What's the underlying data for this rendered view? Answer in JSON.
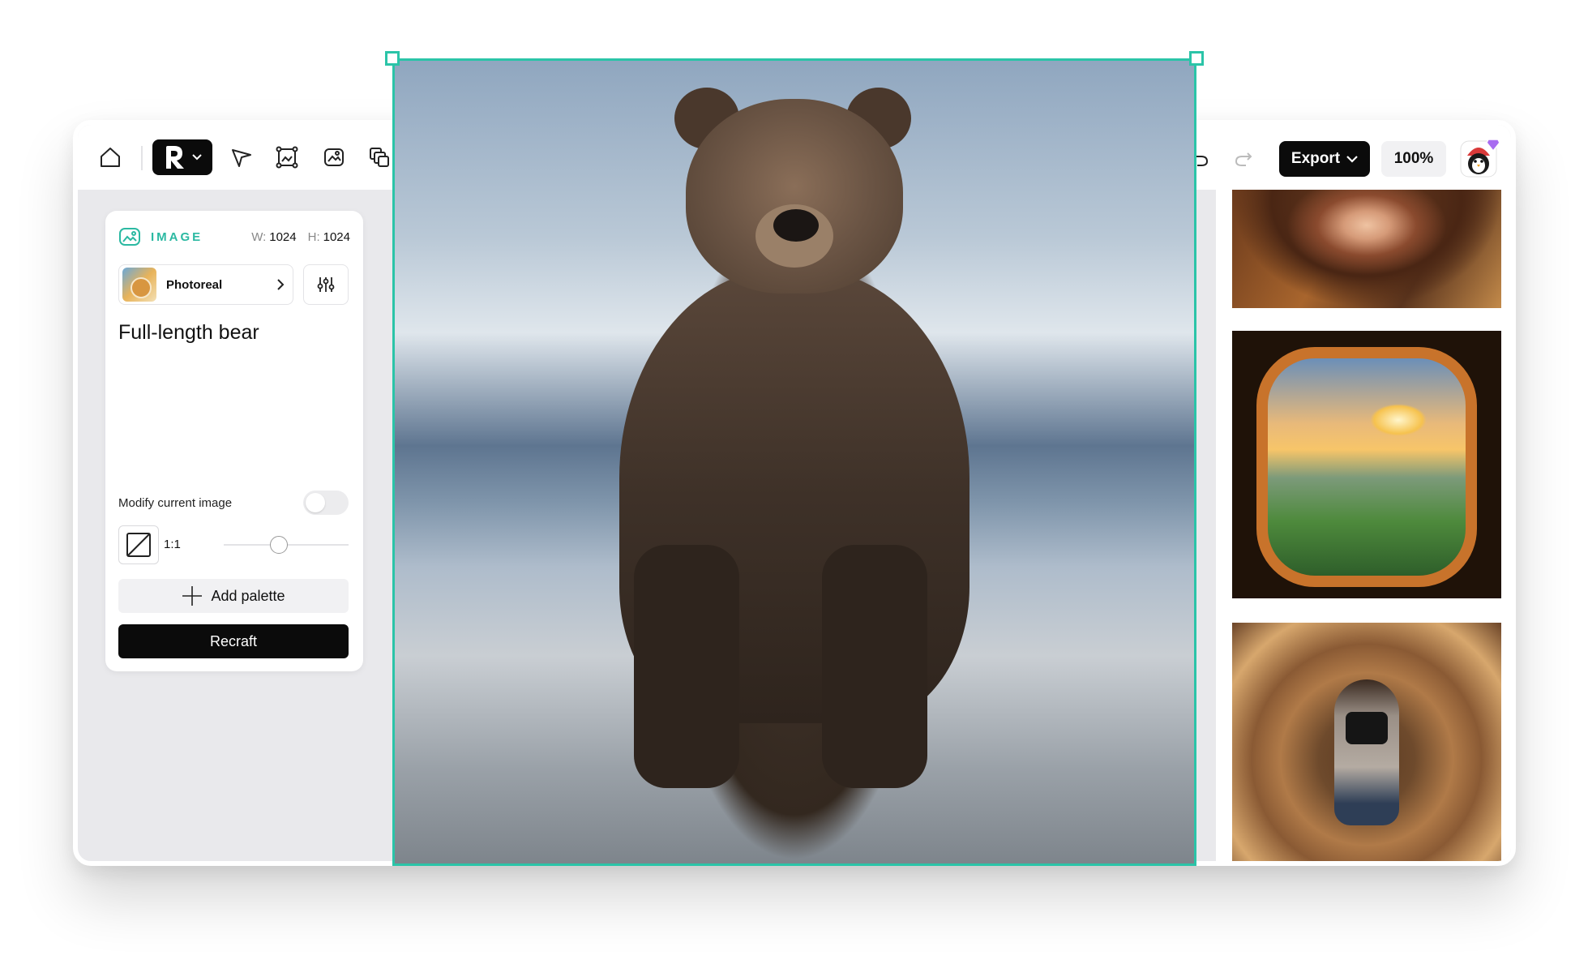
{
  "toolbar": {
    "home_icon": "home-icon",
    "brand_icon": "recraft-logo-icon",
    "tools": [
      "pen-tool-icon",
      "frame-select-icon",
      "image-generate-icon",
      "layers-icon"
    ],
    "undo_icon": "undo-icon",
    "redo_icon": "redo-icon",
    "export_label": "Export",
    "zoom_label": "100%",
    "avatar_icon": "user-avatar-icon"
  },
  "panel": {
    "type_label": "IMAGE",
    "width_key": "W:",
    "width_value": "1024",
    "height_key": "H:",
    "height_value": "1024",
    "style_name": "Photoreal",
    "prompt": "Full-length bear",
    "modify_label": "Modify current image",
    "modify_enabled": false,
    "ratio_label": "1:1",
    "add_palette_label": "Add palette",
    "recraft_label": "Recraft"
  },
  "colors": {
    "accent": "#2bc4a8",
    "dark": "#0b0b0b"
  }
}
